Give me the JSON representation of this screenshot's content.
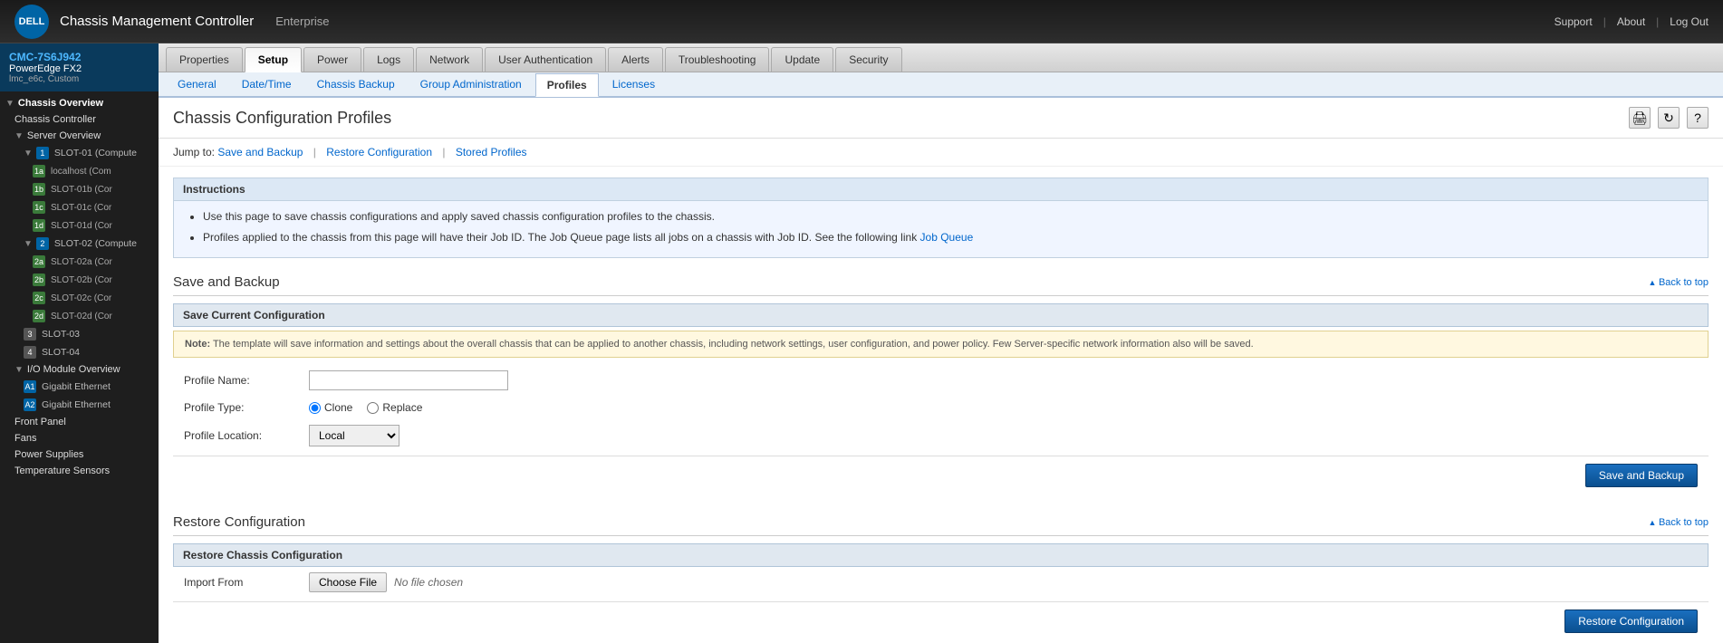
{
  "header": {
    "logo_text": "DELL",
    "app_title": "Chassis Management Controller",
    "edition": "Enterprise",
    "nav_links": [
      {
        "label": "Support",
        "id": "support"
      },
      {
        "label": "About",
        "id": "about"
      },
      {
        "label": "Log Out",
        "id": "logout"
      }
    ]
  },
  "sidebar": {
    "device": {
      "id": "CMC-7S6J942",
      "model": "PowerEdge FX2",
      "sub": "lmc_e6c, Custom"
    },
    "tree": [
      {
        "label": "Chassis Overview",
        "level": 0,
        "toggle": "▼",
        "bullet": null
      },
      {
        "label": "Chassis Controller",
        "level": 1,
        "toggle": null,
        "bullet": null
      },
      {
        "label": "Server Overview",
        "level": 1,
        "toggle": "▼",
        "bullet": null
      },
      {
        "label": "1  SLOT-01 (Compute",
        "level": 2,
        "toggle": "▼",
        "bullet": null
      },
      {
        "label": "1a  localhost (Com",
        "level": 3,
        "toggle": null,
        "bullet": "1a"
      },
      {
        "label": "1b  SLOT-01b (Cor",
        "level": 3,
        "toggle": null,
        "bullet": "1b"
      },
      {
        "label": "1c  SLOT-01c (Cor",
        "level": 3,
        "toggle": null,
        "bullet": "1c"
      },
      {
        "label": "1d  SLOT-01d (Cor",
        "level": 3,
        "toggle": null,
        "bullet": "1d"
      },
      {
        "label": "2  SLOT-02 (Compute",
        "level": 2,
        "toggle": "▼",
        "bullet": null
      },
      {
        "label": "2a  SLOT-02a (Cor",
        "level": 3,
        "toggle": null,
        "bullet": "2a"
      },
      {
        "label": "2b  SLOT-02b (Cor",
        "level": 3,
        "toggle": null,
        "bullet": "2b"
      },
      {
        "label": "2c  SLOT-02c (Cor",
        "level": 3,
        "toggle": null,
        "bullet": "2c"
      },
      {
        "label": "2d  SLOT-02d (Cor",
        "level": 3,
        "toggle": null,
        "bullet": "2d"
      },
      {
        "label": "3  SLOT-03",
        "level": 2,
        "toggle": null,
        "bullet": null
      },
      {
        "label": "4  SLOT-04",
        "level": 2,
        "toggle": null,
        "bullet": null
      },
      {
        "label": "I/O Module Overview",
        "level": 1,
        "toggle": "▼",
        "bullet": null
      },
      {
        "label": "A1  Gigabit Ethernet",
        "level": 2,
        "toggle": null,
        "bullet": "A1"
      },
      {
        "label": "A2  Gigabit Ethernet",
        "level": 2,
        "toggle": null,
        "bullet": "A2"
      },
      {
        "label": "Front Panel",
        "level": 1,
        "toggle": null,
        "bullet": null
      },
      {
        "label": "Fans",
        "level": 1,
        "toggle": null,
        "bullet": null
      },
      {
        "label": "Power Supplies",
        "level": 1,
        "toggle": null,
        "bullet": null
      },
      {
        "label": "Temperature Sensors",
        "level": 1,
        "toggle": null,
        "bullet": null
      }
    ]
  },
  "top_tabs": [
    {
      "label": "Properties",
      "id": "properties",
      "active": false
    },
    {
      "label": "Setup",
      "id": "setup",
      "active": true
    },
    {
      "label": "Power",
      "id": "power",
      "active": false
    },
    {
      "label": "Logs",
      "id": "logs",
      "active": false
    },
    {
      "label": "Network",
      "id": "network",
      "active": false
    },
    {
      "label": "User Authentication",
      "id": "user-auth",
      "active": false
    },
    {
      "label": "Alerts",
      "id": "alerts",
      "active": false
    },
    {
      "label": "Troubleshooting",
      "id": "troubleshooting",
      "active": false
    },
    {
      "label": "Update",
      "id": "update",
      "active": false
    },
    {
      "label": "Security",
      "id": "security",
      "active": false
    }
  ],
  "sub_tabs": [
    {
      "label": "General",
      "id": "general",
      "active": false
    },
    {
      "label": "Date/Time",
      "id": "datetime",
      "active": false
    },
    {
      "label": "Chassis Backup",
      "id": "chassis-backup",
      "active": false
    },
    {
      "label": "Group Administration",
      "id": "group-admin",
      "active": false
    },
    {
      "label": "Profiles",
      "id": "profiles",
      "active": true
    },
    {
      "label": "Licenses",
      "id": "licenses",
      "active": false
    }
  ],
  "page": {
    "title": "Chassis Configuration Profiles",
    "jump_to_label": "Jump to:",
    "jump_links": [
      {
        "label": "Save and Backup",
        "href": "#save-backup"
      },
      {
        "label": "Restore Configuration",
        "href": "#restore-config"
      },
      {
        "label": "Stored Profiles",
        "href": "#stored-profiles"
      }
    ],
    "instructions": {
      "header": "Instructions",
      "bullets": [
        "Use this page to save chassis configurations and apply saved chassis configuration profiles to the chassis.",
        "Profiles applied to the chassis from this page will have their Job ID. The Job Queue page lists all jobs on a chassis with Job ID. See the following link Job Queue"
      ],
      "job_queue_link": "Job Queue"
    },
    "save_backup_section": {
      "title": "Save and Backup",
      "back_to_top": "Back to top",
      "subsection_title": "Save Current Configuration",
      "note": "Note: The template will save information and settings about the overall chassis that can be applied to another chassis, including network settings, user configuration, and power policy. Few Server-specific network information also will be saved.",
      "fields": {
        "profile_name_label": "Profile Name:",
        "profile_name_value": "",
        "profile_name_placeholder": "",
        "profile_type_label": "Profile Type:",
        "profile_type_options": [
          {
            "label": "Clone",
            "value": "clone",
            "checked": true
          },
          {
            "label": "Replace",
            "value": "replace",
            "checked": false
          }
        ],
        "profile_location_label": "Profile Location:",
        "profile_location_options": [
          {
            "label": "Local",
            "value": "local"
          }
        ],
        "profile_location_selected": "local"
      },
      "save_button": "Save and Backup"
    },
    "restore_section": {
      "title": "Restore Configuration",
      "back_to_top": "Back to top",
      "subsection_title": "Restore Chassis Configuration",
      "import_from_label": "Import From",
      "choose_file_label": "Choose File",
      "no_file_text": "No file chosen",
      "restore_button": "Restore Configuration"
    }
  }
}
